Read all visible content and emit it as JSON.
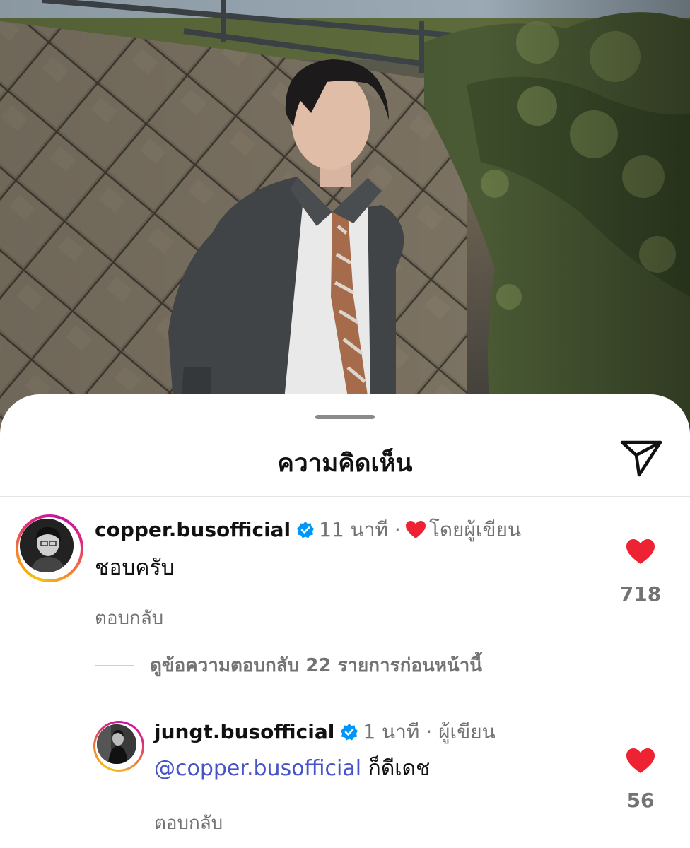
{
  "colors": {
    "verified": "#0095f6",
    "heart": "#ed2233",
    "mention": "#4753c8",
    "muted": "#737373"
  },
  "sheet": {
    "title": "ความคิดเห็น",
    "share_icon": "paper-plane-icon"
  },
  "comments": [
    {
      "username": "copper.busofficial",
      "verified": true,
      "time": "11 นาที",
      "separator": "·",
      "liked_by_author_icon": "heart-icon",
      "liked_by_author_label": "โดยผู้เขียน",
      "text": "ชอบครับ",
      "reply_label": "ตอบกลับ",
      "likes": "718"
    },
    {
      "username": "jungt.busofficial",
      "verified": true,
      "time": "1 นาที",
      "separator": "·",
      "author_label": "ผู้เขียน",
      "mention": "@copper.busofficial",
      "text": "ก็ดีเดช",
      "reply_label": "ตอบกลับ",
      "likes": "56"
    }
  ],
  "view_previous_replies": "ดูข้อความตอบกลับ 22 รายการก่อนหน้านี้"
}
